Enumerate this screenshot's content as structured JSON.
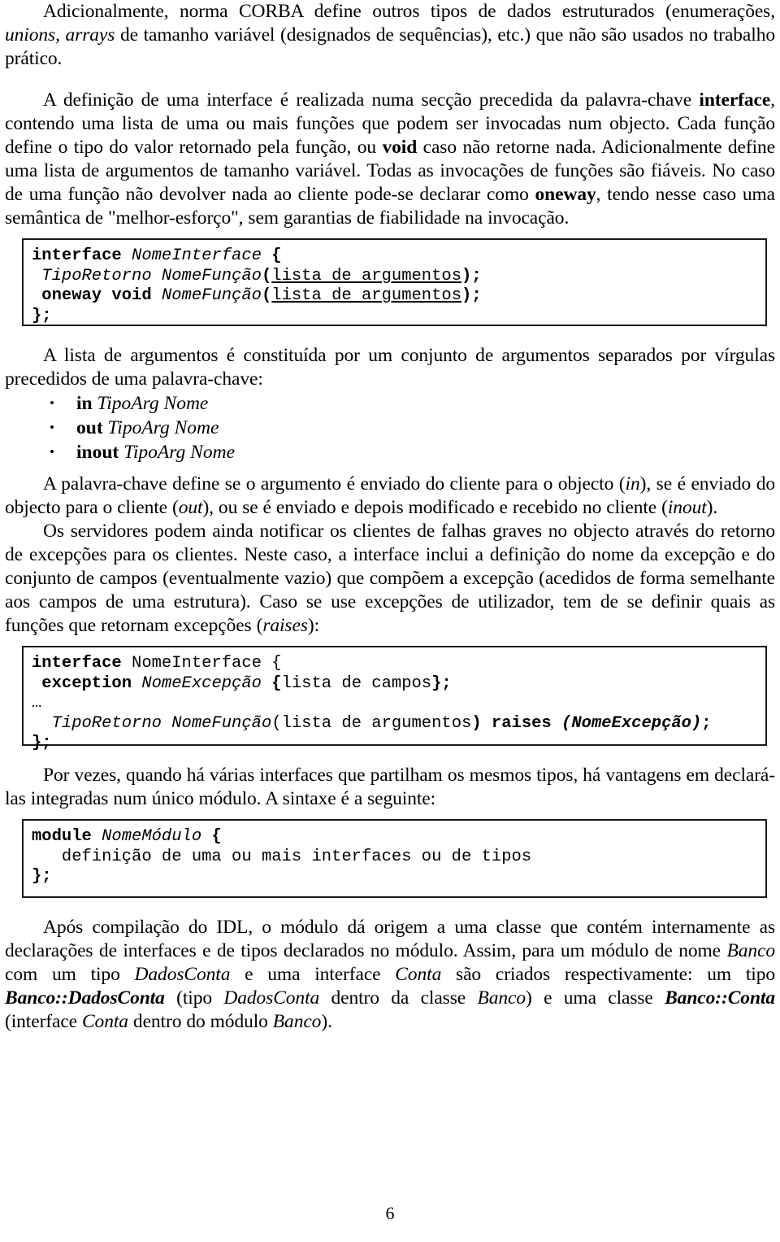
{
  "document": {
    "page_number": "6",
    "paragraphs": {
      "p1": {
        "segments": [
          {
            "text": "Adicionalmente, norma CORBA define outros tipos de dados estruturados (enumerações, ",
            "style": "normal"
          },
          {
            "text": "unions",
            "style": "italic"
          },
          {
            "text": ", ",
            "style": "normal"
          },
          {
            "text": "arrays",
            "style": "italic"
          },
          {
            "text": " de tamanho variável (designados de sequências), etc.) que não são usados no trabalho prático.",
            "style": "normal"
          }
        ]
      },
      "p2": {
        "segments": [
          {
            "text": "A definição de uma interface é realizada numa secção precedida da palavra-chave ",
            "style": "normal"
          },
          {
            "text": "interface",
            "style": "bold"
          },
          {
            "text": ", contendo uma lista de uma ou mais funções que podem ser invocadas num objecto. Cada função define o tipo do valor retornado pela função, ou ",
            "style": "normal"
          },
          {
            "text": "void",
            "style": "bold"
          },
          {
            "text": " caso não retorne nada. Adicionalmente define uma lista de argumentos de tamanho variável. Todas as invocações de funções são fiáveis. No caso de uma função não devolver nada ao cliente pode-se declarar como ",
            "style": "normal"
          },
          {
            "text": "oneway",
            "style": "bold"
          },
          {
            "text": ", tendo nesse caso uma semântica de \"melhor-esforço\", sem garantias de fiabilidade na invocação.",
            "style": "normal"
          }
        ]
      },
      "p3": {
        "segments": [
          {
            "text": "A lista de argumentos é constituída por um conjunto de argumentos separados por vírgulas precedidos de uma palavra-chave:",
            "style": "normal"
          }
        ]
      },
      "p4": {
        "segments": [
          {
            "text": "A palavra-chave define se o argumento é enviado do cliente para o objecto (",
            "style": "normal"
          },
          {
            "text": "in",
            "style": "italic"
          },
          {
            "text": "), se é enviado do objecto para o cliente (",
            "style": "normal"
          },
          {
            "text": "out",
            "style": "italic"
          },
          {
            "text": "), ou se é enviado e depois modificado e recebido no cliente (",
            "style": "normal"
          },
          {
            "text": "inout",
            "style": "italic"
          },
          {
            "text": ").",
            "style": "normal"
          }
        ]
      },
      "p5": {
        "segments": [
          {
            "text": "Os servidores podem ainda notificar os clientes de falhas graves no objecto através do retorno de excepções para os clientes. Neste caso, a interface inclui a definição do nome da excepção e do conjunto de campos (eventualmente vazio) que compõem a excepção (acedidos de forma semelhante aos campos de uma estrutura). Caso se use excepções de utilizador, tem de se definir quais as funções que retornam excepções (",
            "style": "normal"
          },
          {
            "text": "raises",
            "style": "italic"
          },
          {
            "text": "):",
            "style": "normal"
          }
        ]
      },
      "p6": {
        "segments": [
          {
            "text": "Por vezes, quando há várias interfaces que partilham os mesmos tipos, há vantagens em declará-las integradas num único módulo. A sintaxe é a seguinte:",
            "style": "normal"
          }
        ]
      },
      "p7": {
        "segments": [
          {
            "text": "Após compilação do IDL, o módulo dá origem a uma classe que contém internamente as declarações de interfaces e de tipos declarados no módulo. Assim, para um módulo de nome ",
            "style": "normal"
          },
          {
            "text": "Banco",
            "style": "italic"
          },
          {
            "text": " com um tipo ",
            "style": "normal"
          },
          {
            "text": "DadosConta",
            "style": "italic"
          },
          {
            "text": " e uma interface ",
            "style": "normal"
          },
          {
            "text": "Conta",
            "style": "italic"
          },
          {
            "text": " são criados respectivamente: um tipo ",
            "style": "normal"
          },
          {
            "text": "Banco::DadosConta",
            "style": "bold-italic"
          },
          {
            "text": " (tipo ",
            "style": "normal"
          },
          {
            "text": "DadosConta",
            "style": "italic"
          },
          {
            "text": " dentro da classe ",
            "style": "normal"
          },
          {
            "text": "Banco",
            "style": "italic"
          },
          {
            "text": ") e uma classe ",
            "style": "normal"
          },
          {
            "text": "Banco::Conta",
            "style": "bold-italic"
          },
          {
            "text": " (interface ",
            "style": "normal"
          },
          {
            "text": "Conta",
            "style": "italic"
          },
          {
            "text": " dentro do módulo ",
            "style": "normal"
          },
          {
            "text": "Banco",
            "style": "italic"
          },
          {
            "text": ").",
            "style": "normal"
          }
        ]
      }
    },
    "keyword_list": {
      "items": [
        {
          "bullet": "•",
          "keyword": "in",
          "rest": " TipoArg Nome"
        },
        {
          "bullet": "•",
          "keyword": "out",
          "rest": " TipoArg Nome"
        },
        {
          "bullet": "•",
          "keyword": "inout",
          "rest": " TipoArg Nome"
        }
      ]
    },
    "code_blocks": {
      "interface_block": {
        "lines": [
          [
            {
              "text": "interface ",
              "style": "bold"
            },
            {
              "text": "NomeInterface ",
              "style": "italic"
            },
            {
              "text": "{",
              "style": "bold"
            }
          ],
          [
            {
              "text": " TipoRetorno NomeFunção",
              "style": "italic"
            },
            {
              "text": "(",
              "style": "bold"
            },
            {
              "text": "lista de argumentos",
              "style": "underline"
            },
            {
              "text": ");",
              "style": "bold"
            }
          ],
          [
            {
              "text": " oneway void ",
              "style": "bold"
            },
            {
              "text": "NomeFunção",
              "style": "italic"
            },
            {
              "text": "(",
              "style": "bold"
            },
            {
              "text": "lista de argumentos",
              "style": "underline"
            },
            {
              "text": ");",
              "style": "bold"
            }
          ],
          [
            {
              "text": "};",
              "style": "bold"
            }
          ]
        ]
      },
      "exception_block": {
        "lines": [
          [
            {
              "text": "interface ",
              "style": "bold"
            },
            {
              "text": "NomeInterface {",
              "style": "normal"
            }
          ],
          [
            {
              "text": " exception ",
              "style": "bold"
            },
            {
              "text": "NomeExcepção ",
              "style": "italic"
            },
            {
              "text": "{",
              "style": "bold"
            },
            {
              "text": "lista de campos",
              "style": "normal"
            },
            {
              "text": "};",
              "style": "bold"
            }
          ],
          [
            {
              "text": "…",
              "style": "normal"
            }
          ],
          [
            {
              "text": "  TipoRetorno NomeFunção",
              "style": "italic"
            },
            {
              "text": "(",
              "style": "normal"
            },
            {
              "text": "lista de argumentos",
              "style": "normal"
            },
            {
              "text": ") ",
              "style": "bold"
            },
            {
              "text": "raises ",
              "style": "bold"
            },
            {
              "text": "(NomeExcepção)",
              "style": "bold-italic"
            },
            {
              "text": ";",
              "style": "bold"
            }
          ],
          [
            {
              "text": "};",
              "style": "bold"
            }
          ]
        ]
      },
      "module_block": {
        "lines": [
          [
            {
              "text": "module ",
              "style": "bold"
            },
            {
              "text": "NomeMódulo ",
              "style": "italic"
            },
            {
              "text": "{",
              "style": "bold"
            }
          ],
          [
            {
              "text": "   definição de uma ou mais interfaces ou de tipos",
              "style": "normal"
            }
          ],
          [
            {
              "text": "};",
              "style": "bold"
            }
          ]
        ]
      }
    }
  }
}
